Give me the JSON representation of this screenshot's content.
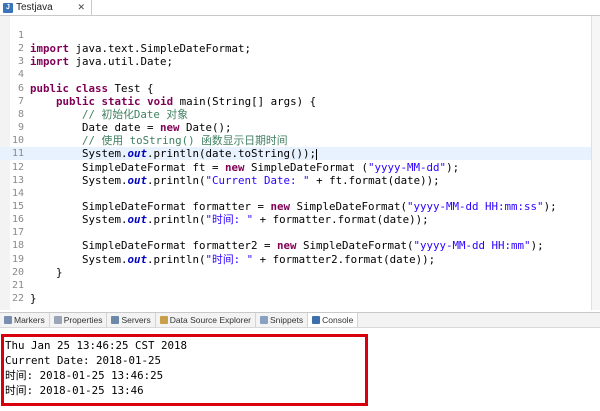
{
  "editor_tab": {
    "label": "Testjava",
    "icon": "java-file-icon"
  },
  "code_lines": [
    {
      "n": "1",
      "segs": []
    },
    {
      "n": "2",
      "segs": [
        [
          "kw",
          "import"
        ],
        [
          "t",
          " java.text.SimpleDateFormat;"
        ]
      ]
    },
    {
      "n": "3",
      "segs": [
        [
          "kw",
          "import"
        ],
        [
          "t",
          " java.util.Date;"
        ]
      ]
    },
    {
      "n": "4",
      "segs": []
    },
    {
      "n": "6",
      "segs": [
        [
          "kw",
          "public"
        ],
        [
          "t",
          " "
        ],
        [
          "kw",
          "class"
        ],
        [
          "t",
          " Test {"
        ]
      ]
    },
    {
      "n": "7",
      "segs": [
        [
          "t",
          "    "
        ],
        [
          "kw",
          "public"
        ],
        [
          "t",
          " "
        ],
        [
          "kw",
          "static"
        ],
        [
          "t",
          " "
        ],
        [
          "kw",
          "void"
        ],
        [
          "t",
          " main(String[] args) {"
        ]
      ]
    },
    {
      "n": "8",
      "segs": [
        [
          "t",
          "        "
        ],
        [
          "cmt",
          "// 初始化Date 对象"
        ]
      ]
    },
    {
      "n": "9",
      "segs": [
        [
          "t",
          "        Date date = "
        ],
        [
          "kw",
          "new"
        ],
        [
          "t",
          " Date();"
        ]
      ]
    },
    {
      "n": "10",
      "segs": [
        [
          "t",
          "        "
        ],
        [
          "cmt",
          "// 使用 toString() 函数显示日期时间"
        ]
      ]
    },
    {
      "n": "11",
      "segs": [
        [
          "t",
          "        System."
        ],
        [
          "fld",
          "out"
        ],
        [
          "t",
          ".println(date.toString());"
        ]
      ]
    },
    {
      "n": "12",
      "segs": [
        [
          "t",
          "        SimpleDateFormat ft = "
        ],
        [
          "kw",
          "new"
        ],
        [
          "t",
          " SimpleDateFormat ("
        ],
        [
          "str",
          "\"yyyy-MM-dd\""
        ],
        [
          "t",
          ");"
        ]
      ]
    },
    {
      "n": "13",
      "segs": [
        [
          "t",
          "        System."
        ],
        [
          "fld",
          "out"
        ],
        [
          "t",
          ".println("
        ],
        [
          "str",
          "\"Current Date: \""
        ],
        [
          "t",
          " + ft.format(date));"
        ]
      ]
    },
    {
      "n": "14",
      "segs": []
    },
    {
      "n": "15",
      "segs": [
        [
          "t",
          "        SimpleDateFormat formatter = "
        ],
        [
          "kw",
          "new"
        ],
        [
          "t",
          " SimpleDateFormat("
        ],
        [
          "str",
          "\"yyyy-MM-dd HH:mm:ss\""
        ],
        [
          "t",
          ");"
        ]
      ]
    },
    {
      "n": "16",
      "segs": [
        [
          "t",
          "        System."
        ],
        [
          "fld",
          "out"
        ],
        [
          "t",
          ".println("
        ],
        [
          "str",
          "\"时间: \""
        ],
        [
          "t",
          " + formatter.format(date));"
        ]
      ]
    },
    {
      "n": "17",
      "segs": []
    },
    {
      "n": "18",
      "segs": [
        [
          "t",
          "        SimpleDateFormat formatter2 = "
        ],
        [
          "kw",
          "new"
        ],
        [
          "t",
          " SimpleDateFormat("
        ],
        [
          "str",
          "\"yyyy-MM-dd HH:mm\""
        ],
        [
          "t",
          ");"
        ]
      ]
    },
    {
      "n": "19",
      "segs": [
        [
          "t",
          "        System."
        ],
        [
          "fld",
          "out"
        ],
        [
          "t",
          ".println("
        ],
        [
          "str",
          "\"时间: \""
        ],
        [
          "t",
          " + formatter2.format(date));"
        ]
      ]
    },
    {
      "n": "20",
      "segs": [
        [
          "t",
          "    }"
        ]
      ]
    },
    {
      "n": "21",
      "segs": []
    },
    {
      "n": "22",
      "segs": [
        [
          "t",
          "}"
        ]
      ]
    }
  ],
  "current_line": "11",
  "view_tabs": [
    {
      "label": "Markers",
      "icon": "markers-icon",
      "color": "#7a8fb0"
    },
    {
      "label": "Properties",
      "icon": "properties-icon",
      "color": "#9aa6b8"
    },
    {
      "label": "Servers",
      "icon": "servers-icon",
      "color": "#6b88a8"
    },
    {
      "label": "Data Source Explorer",
      "icon": "data-source-icon",
      "color": "#c8a04a"
    },
    {
      "label": "Snippets",
      "icon": "snippets-icon",
      "color": "#8aa0c0"
    },
    {
      "label": "Console",
      "icon": "console-icon",
      "color": "#3b6fb0",
      "active": true
    }
  ],
  "console_output": [
    "Thu Jan 25 13:46:25 CST 2018",
    "Current Date: 2018-01-25",
    "时间: 2018-01-25 13:46:25",
    "时间: 2018-01-25 13:46"
  ],
  "colors": {
    "highlight_border": "#d9000d",
    "keyword": "#7f0055",
    "string": "#2a00ff",
    "comment": "#3f7f5f"
  }
}
